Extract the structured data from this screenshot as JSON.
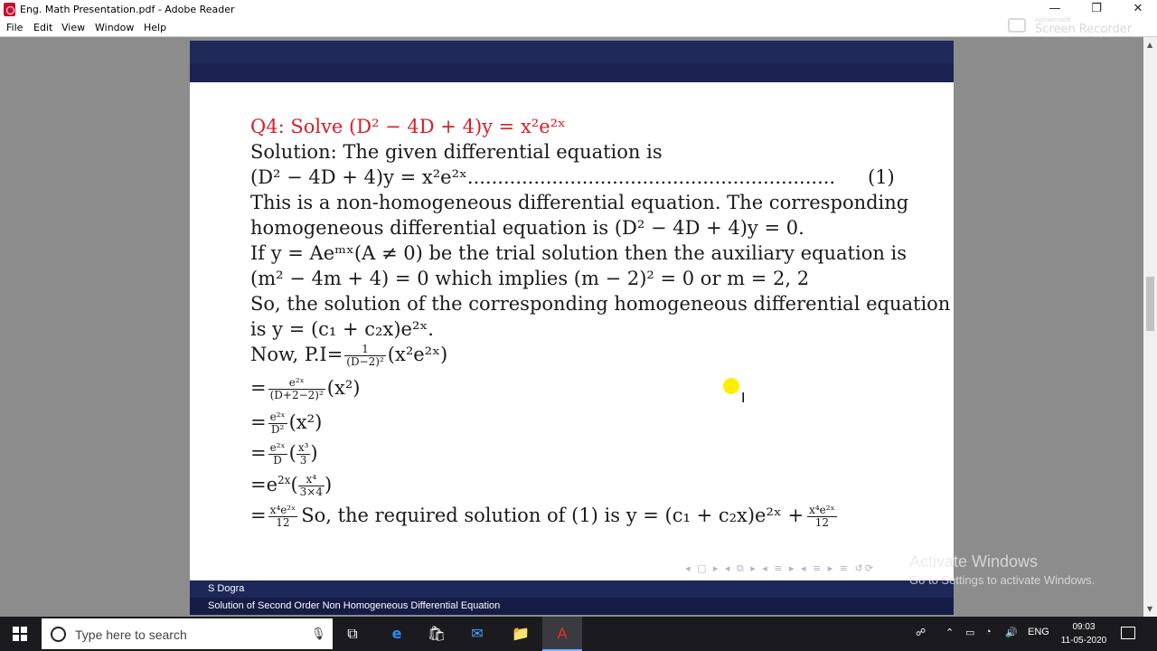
{
  "window": {
    "title": "Eng. Math Presentation.pdf - Adobe Reader",
    "minimize_glyph": "—",
    "restore_glyph": "❐",
    "close_glyph": "✕"
  },
  "menu": {
    "items": [
      "File",
      "Edit",
      "View",
      "Window",
      "Help"
    ]
  },
  "recorder_watermark": {
    "top": "Apowersoft",
    "main": "Screen Recorder"
  },
  "slide": {
    "lines": [
      "Q4: Solve (D² − 4D + 4)y = x²e²ˣ",
      "Solution: The given differential equation is",
      "(D² − 4D + 4)y = x²e²ˣ.............................................................",
      "This is a non-homogeneous differential equation. The corresponding",
      "homogeneous differential equation is (D² − 4D + 4)y = 0.",
      "If y = Aeᵐˣ(A ≠ 0) be the trial solution then the auxiliary equation is",
      "(m² − 4m + 4) = 0 which implies (m − 2)² = 0 or m = 2, 2",
      "So, the solution of the corresponding homogeneous differential equation",
      "is y = (c₁ + c₂x)e²ˣ.",
      "Now, P.I=",
      "=",
      "=",
      "=",
      "=e",
      "=",
      "So, the required solution of (1) is y = (c₁ + c₂x)e²ˣ +"
    ],
    "eq_number": "(1)",
    "fractions": {
      "pi_num": "1",
      "pi_den": "(D−2)²",
      "pi_after": "(x²e²ˣ)",
      "s1_num": "e²ˣ",
      "s1_den": "(D+2−2)²",
      "s1_after": "(x²)",
      "s2_num": "e²ˣ",
      "s2_den": "D²",
      "s2_after": "(x²)",
      "s3_num": "e²ˣ",
      "s3_den": "D",
      "s3_inner_num": "x³",
      "s3_inner_den": "3",
      "s4_exp": "2x",
      "s4_inner_num": "x⁴",
      "s4_inner_den": "3×4",
      "s5_num": "x⁴e²ˣ",
      "s5_den": "12",
      "final_num": "x⁴e²ˣ",
      "final_den": "12"
    },
    "footer_author": "S Dogra",
    "footer_title": "Solution of Second Order Non Homogeneous Differential Equation",
    "nav_glyphs": "◂ ▢ ▸ ◂ ⧉ ▸ ◂ ≡ ▸ ◂ ≡ ▸   ≡   ↺⟳"
  },
  "activation": {
    "line1": "Activate Windows",
    "line2": "Go to Settings to activate Windows."
  },
  "taskbar": {
    "search_placeholder": "Type here to search",
    "language": "ENG",
    "time": "09:03",
    "date": "11-05-2020"
  },
  "colors": {
    "slide_header": "#202a5a",
    "question_red": "#d3202a",
    "taskbar": "#1b1b1f"
  }
}
